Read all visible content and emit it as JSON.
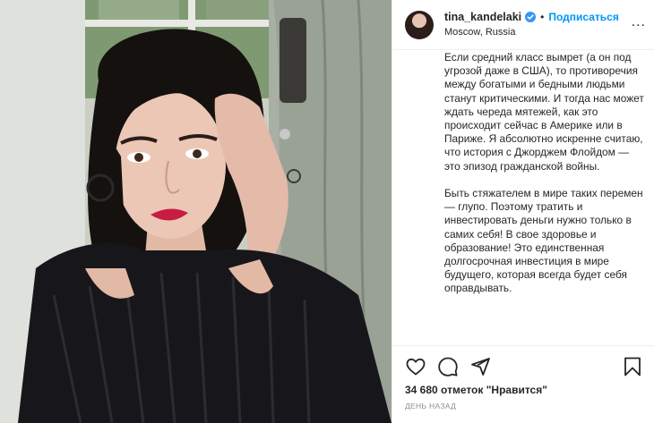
{
  "user": {
    "username": "tina_kandelaki",
    "location": "Moscow, Russia",
    "follow_label": "Подписаться",
    "separator": "•",
    "more_label": "..."
  },
  "caption": {
    "paragraphs": [
      "Если средний класс вымрет (а он под угрозой даже в США), то противоречия между богатыми и бедными людьми станут критическими. И тогда нас может ждать череда мятежей, как это происходит сейчас в Америке или в Париже. Я абсолютно искренне считаю, что история с Джорджем Флойдом — это эпизод гражданской войны.",
      "Быть стяжателем в мире таких перемен — глупо. Поэтому тратить и инвестировать деньги нужно только в самих себя! В свое здоровье и образование! Это единственная долгосрочная инвестиция в мире будущего, которая всегда будет себя оправдывать."
    ]
  },
  "actions": {
    "likes_text": "34 680 отметок \"Нравится\"",
    "time_ago": "ДЕНЬ НАЗАД"
  },
  "icons": {
    "verified": "verified-badge-icon",
    "like": "heart-icon",
    "comment": "comment-bubble-icon",
    "share": "paper-plane-icon",
    "save": "bookmark-icon",
    "more": "more-options-icon"
  },
  "colors": {
    "accent": "#0095f6",
    "text": "#262626",
    "muted": "#8e8e8e",
    "border": "#efefef"
  }
}
